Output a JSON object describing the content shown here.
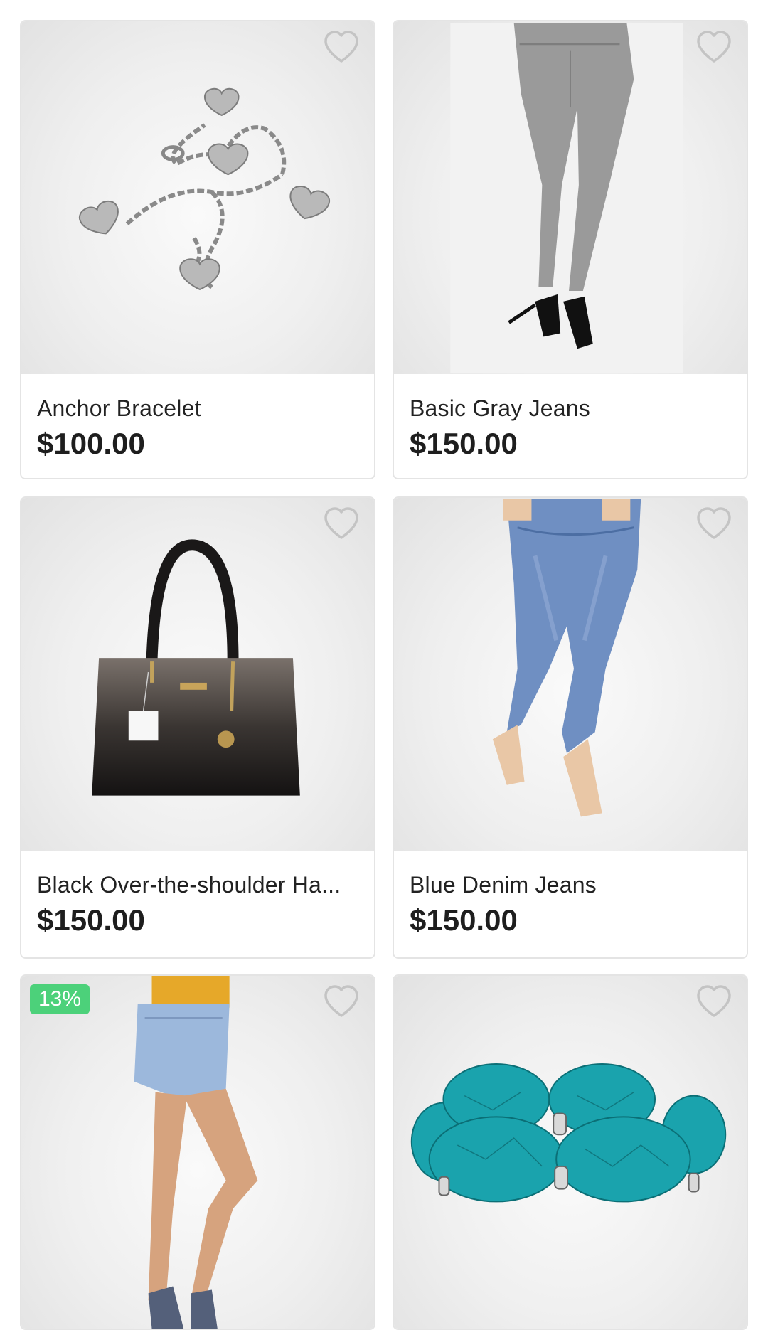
{
  "products": [
    {
      "name": "Anchor Bracelet",
      "price": "$100.00",
      "image": "heart-charm-bracelet"
    },
    {
      "name": "Basic Gray Jeans",
      "price": "$150.00",
      "image": "gray-jeans-model"
    },
    {
      "name": "Black Over-the-shoulder Ha...",
      "price": "$150.00",
      "image": "black-handbag"
    },
    {
      "name": "Blue Denim Jeans",
      "price": "$150.00",
      "image": "blue-jeans-model"
    },
    {
      "discount_badge": "13%",
      "image": "denim-shorts-model"
    },
    {
      "image": "turquoise-bracelet"
    }
  ],
  "icons": {
    "favorite": "heart-outline-icon"
  },
  "colors": {
    "badge_green": "#4cd17a",
    "card_border": "#e4e4e4",
    "text": "#222222",
    "icon_gray": "#c4c4c4"
  }
}
